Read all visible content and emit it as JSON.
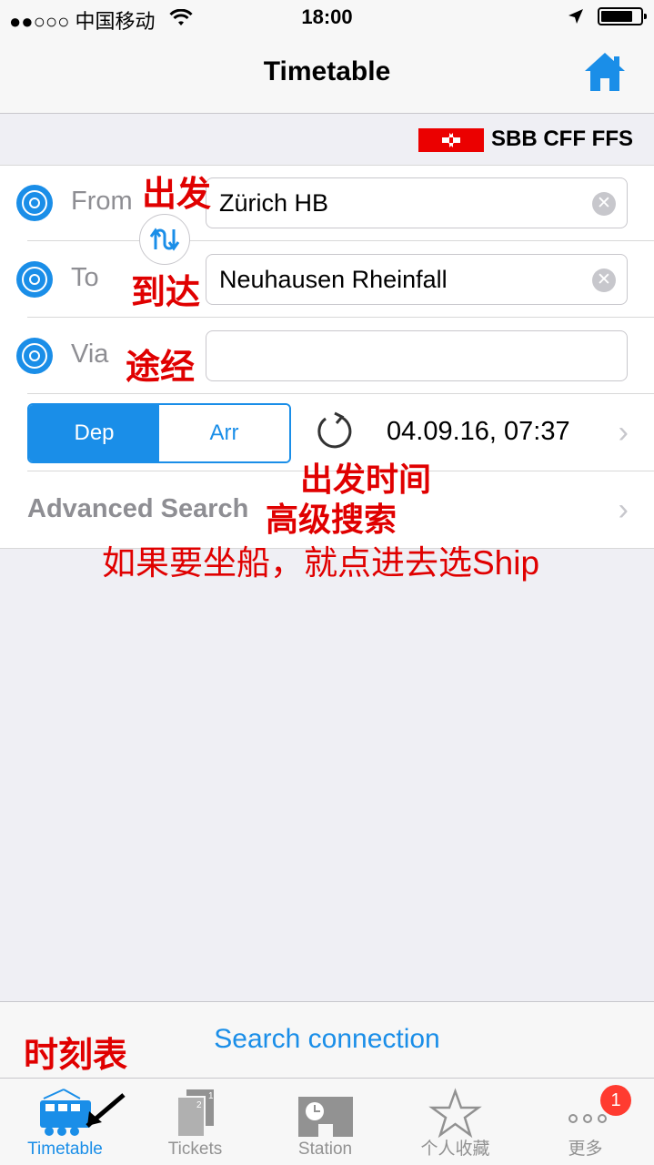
{
  "status_bar": {
    "carrier": "●●○○○ 中国移动",
    "time": "18:00"
  },
  "nav": {
    "title": "Timetable"
  },
  "brand": {
    "name": "SBB CFF FFS"
  },
  "form": {
    "from_label": "From",
    "from_value": "Zürich HB",
    "to_label": "To",
    "to_value": "Neuhausen Rheinfall",
    "via_label": "Via",
    "via_value": "",
    "dep_label": "Dep",
    "arr_label": "Arr",
    "datetime": "04.09.16, 07:37",
    "advanced_search": "Advanced Search"
  },
  "annotations": {
    "from": "出发",
    "to": "到达",
    "via": "途经",
    "departure_time": "出发时间",
    "advanced_search": "高级搜索",
    "ship_hint": "如果要坐船，就点进去选Ship",
    "timetable": "时刻表"
  },
  "search_button": "Search connection",
  "tabs": [
    {
      "label": "Timetable",
      "icon": "train-icon",
      "active": true
    },
    {
      "label": "Tickets",
      "icon": "tickets-icon",
      "active": false
    },
    {
      "label": "Station",
      "icon": "station-icon",
      "active": false
    },
    {
      "label": "个人收藏",
      "icon": "star-icon",
      "active": false
    },
    {
      "label": "更多",
      "icon": "more-dots-icon",
      "active": false,
      "badge": "1"
    }
  ],
  "colors": {
    "accent": "#1a8ee8",
    "annotation": "#e00000",
    "sbb_red": "#eb0000"
  }
}
